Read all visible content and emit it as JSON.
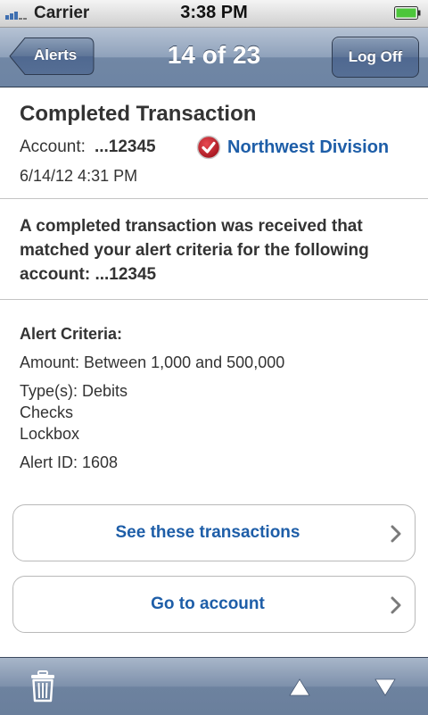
{
  "status_bar": {
    "carrier": "Carrier",
    "time": "3:38 PM"
  },
  "nav": {
    "back_label": "Alerts",
    "title": "14 of 23",
    "logoff_label": "Log Off"
  },
  "header": {
    "title": "Completed Transaction",
    "account_label": "Account:",
    "account_value": "...12345",
    "division": "Northwest Division",
    "datetime": "6/14/12 4:31 PM"
  },
  "message": "A completed transaction was received that matched your alert criteria for the following account: ...12345",
  "criteria": {
    "heading": "Alert Criteria:",
    "amount": "Amount: Between 1,000 and 500,000",
    "types_1": "Type(s): Debits",
    "types_2": "Checks",
    "types_3": "Lockbox",
    "alert_id": "Alert ID: 1608"
  },
  "actions": {
    "see_transactions": "See these transactions",
    "go_to_account": "Go to account"
  },
  "toolbar": {
    "icons": [
      "trash-icon",
      "up-arrow-icon",
      "down-arrow-icon"
    ]
  },
  "colors": {
    "link_blue": "#1e5ea8",
    "check_red": "#c8202a",
    "battery_green": "#4cc63a"
  }
}
